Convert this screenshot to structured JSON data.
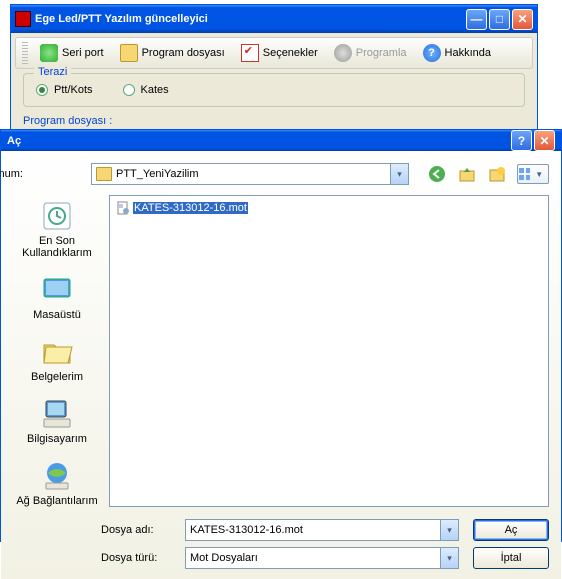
{
  "main_window": {
    "title": "Ege Led/PTT Yazılım güncelleyici",
    "toolbar": {
      "seri_port": "Seri port",
      "program_dosyasi": "Program dosyası",
      "secenekler": "Seçenekler",
      "programla": "Programla",
      "hakkinda": "Hakkında"
    },
    "groupbox": {
      "legend": "Terazi",
      "option1": "Ptt/Kots",
      "option2": "Kates",
      "selected": "Ptt/Kots"
    },
    "truncated_label": "Program dosyası :"
  },
  "dialog": {
    "title": "Aç",
    "location_label": "Konum:",
    "location_value": "PTT_YeniYazilim",
    "places": {
      "recent": "En Son Kullandıklarım",
      "desktop": "Masaüstü",
      "documents": "Belgelerim",
      "computer": "Bilgisayarım",
      "network": "Ağ Bağlantılarım"
    },
    "file_list": [
      {
        "name": "KATES-313012-16.mot",
        "selected": true
      }
    ],
    "filename_label": "Dosya adı:",
    "filename_value": "KATES-313012-16.mot",
    "filetype_label": "Dosya türü:",
    "filetype_value": "Mot Dosyaları",
    "open_btn": "Aç",
    "cancel_btn": "İptal"
  }
}
